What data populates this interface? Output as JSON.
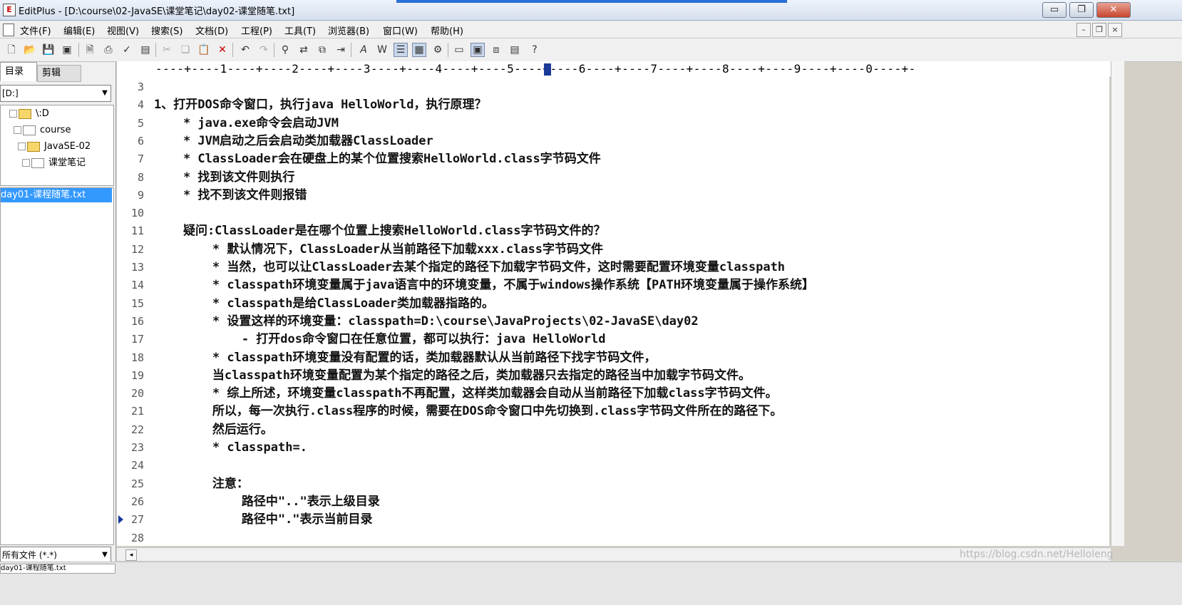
{
  "window": {
    "title": "EditPlus - [D:\\course\\02-JavaSE\\课堂笔记\\day02-课堂随笔.txt]",
    "controls": [
      "▭",
      "❐",
      "✕"
    ]
  },
  "menu": {
    "items": [
      "文件(F)",
      "编辑(E)",
      "视图(V)",
      "搜索(S)",
      "文档(D)",
      "工程(P)",
      "工具(T)",
      "浏览器(B)",
      "窗口(W)",
      "帮助(H)"
    ],
    "mdi_controls": [
      "–",
      "❐",
      "×"
    ]
  },
  "toolbar": {
    "icons": [
      "new-file-icon",
      "open-folder-icon",
      "save-icon",
      "save-all-icon",
      "print-preview-icon",
      "print-icon",
      "spellcheck-icon",
      "document-icon",
      "cut-icon",
      "copy-icon",
      "paste-icon",
      "delete-icon",
      "undo-icon",
      "redo-icon",
      "find-icon",
      "replace-icon",
      "find-in-files-icon",
      "goto-icon",
      "font-icon",
      "word-wrap-icon",
      "line-number-icon",
      "ruler-icon",
      "tools-icon",
      "window-icon",
      "browser-icon",
      "cliptext-icon",
      "directory-icon",
      "help-icon"
    ]
  },
  "sidebar": {
    "tabs": [
      "目录",
      "剪辑"
    ],
    "drive": "[D:]",
    "tree": [
      "\\:D",
      "course",
      "JavaSE-02",
      "课堂笔记"
    ],
    "files": [
      "day01-课程随笔.txt"
    ],
    "filter": "所有文件 (*.*)"
  },
  "ruler": {
    "text": "----+----1----+----2----+----3----+----4----+----5----+----6----+----7----+----8----+----9----+----0----+-"
  },
  "editor": {
    "lines": [
      {
        "n": "3",
        "text": ""
      },
      {
        "n": "4",
        "text": "1、打开DOS命令窗口，执行java HelloWorld，执行原理？"
      },
      {
        "n": "5",
        "text": "    * java.exe命令会启动JVM"
      },
      {
        "n": "6",
        "text": "    * JVM启动之后会启动类加载器ClassLoader"
      },
      {
        "n": "7",
        "text": "    * ClassLoader会在硬盘上的某个位置搜索HelloWorld.class字节码文件"
      },
      {
        "n": "8",
        "text": "    * 找到该文件则执行"
      },
      {
        "n": "9",
        "text": "    * 找不到该文件则报错"
      },
      {
        "n": "10",
        "text": ""
      },
      {
        "n": "11",
        "text": "    疑问:ClassLoader是在哪个位置上搜索HelloWorld.class字节码文件的？"
      },
      {
        "n": "12",
        "text": "        * 默认情况下，ClassLoader从当前路径下加载xxx.class字节码文件"
      },
      {
        "n": "13",
        "text": "        * 当然，也可以让ClassLoader去某个指定的路径下加载字节码文件，这时需要配置环境变量classpath"
      },
      {
        "n": "14",
        "text": "        * classpath环境变量属于java语言中的环境变量，不属于windows操作系统【PATH环境变量属于操作系统】"
      },
      {
        "n": "15",
        "text": "        * classpath是给ClassLoader类加载器指路的。"
      },
      {
        "n": "16",
        "text": "        * 设置这样的环境变量：classpath=D:\\course\\JavaProjects\\02-JavaSE\\day02"
      },
      {
        "n": "17",
        "text": "            - 打开dos命令窗口在任意位置，都可以执行：java HelloWorld"
      },
      {
        "n": "18",
        "text": "        * classpath环境变量没有配置的话，类加载器默认从当前路径下找字节码文件，"
      },
      {
        "n": "19",
        "text": "        当classpath环境变量配置为某个指定的路径之后，类加载器只去指定的路径当中加载字节码文件。"
      },
      {
        "n": "20",
        "text": "        * 综上所述，环境变量classpath不再配置，这样类加载器会自动从当前路径下加载class字节码文件。"
      },
      {
        "n": "21",
        "text": "        所以，每一次执行.class程序的时候，需要在DOS命令窗口中先切换到.class字节码文件所在的路径下。"
      },
      {
        "n": "22",
        "text": "        然后运行。"
      },
      {
        "n": "23",
        "text": "        * classpath=."
      },
      {
        "n": "24",
        "text": ""
      },
      {
        "n": "25",
        "text": "        注意："
      },
      {
        "n": "26",
        "text": "            路径中\"..\"表示上级目录"
      },
      {
        "n": "27",
        "text": "            路径中\".\"表示当前目录"
      },
      {
        "n": "28",
        "text": ""
      }
    ]
  },
  "watermark": "https://blog.csdn.net/Helloleng",
  "statusbar": {
    "doc_tab": "day01-课程随笔.txt"
  },
  "colors": {
    "selection": "#3399ff",
    "caret": "#1a3a9a"
  }
}
